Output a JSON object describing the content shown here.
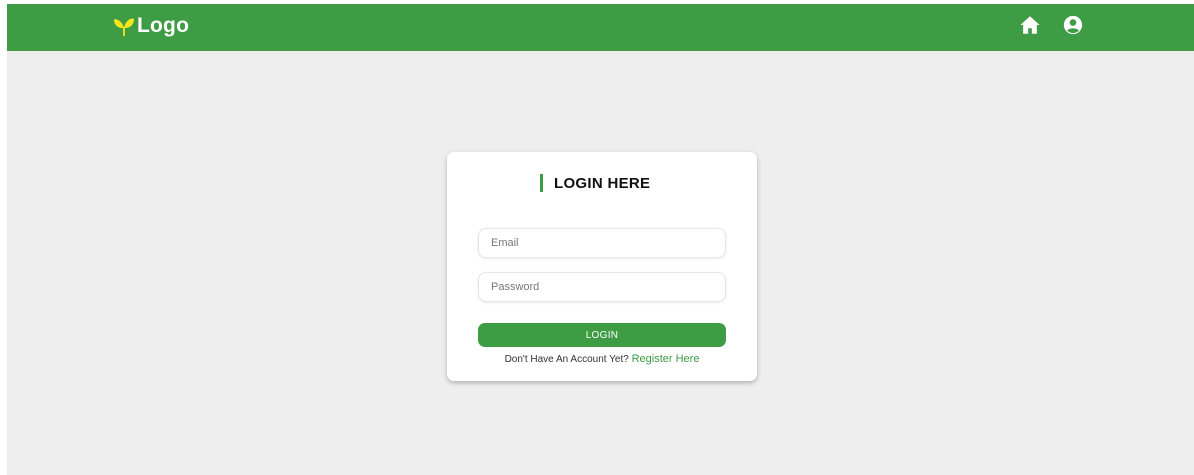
{
  "colors": {
    "brand_green": "#3d9c44",
    "background": "#eeeeee",
    "card": "#ffffff",
    "sprout": "#f5e51b"
  },
  "navbar": {
    "logo_icon": "sprout-icon",
    "logo_text": "Logo",
    "icons": [
      "home-icon",
      "user-circle-icon"
    ]
  },
  "login": {
    "title": "LOGIN HERE",
    "email_placeholder": "Email",
    "password_placeholder": "Password",
    "login_button": "LOGIN",
    "register_prompt": "Don't Have An Account Yet?",
    "register_link": "Register Here"
  }
}
